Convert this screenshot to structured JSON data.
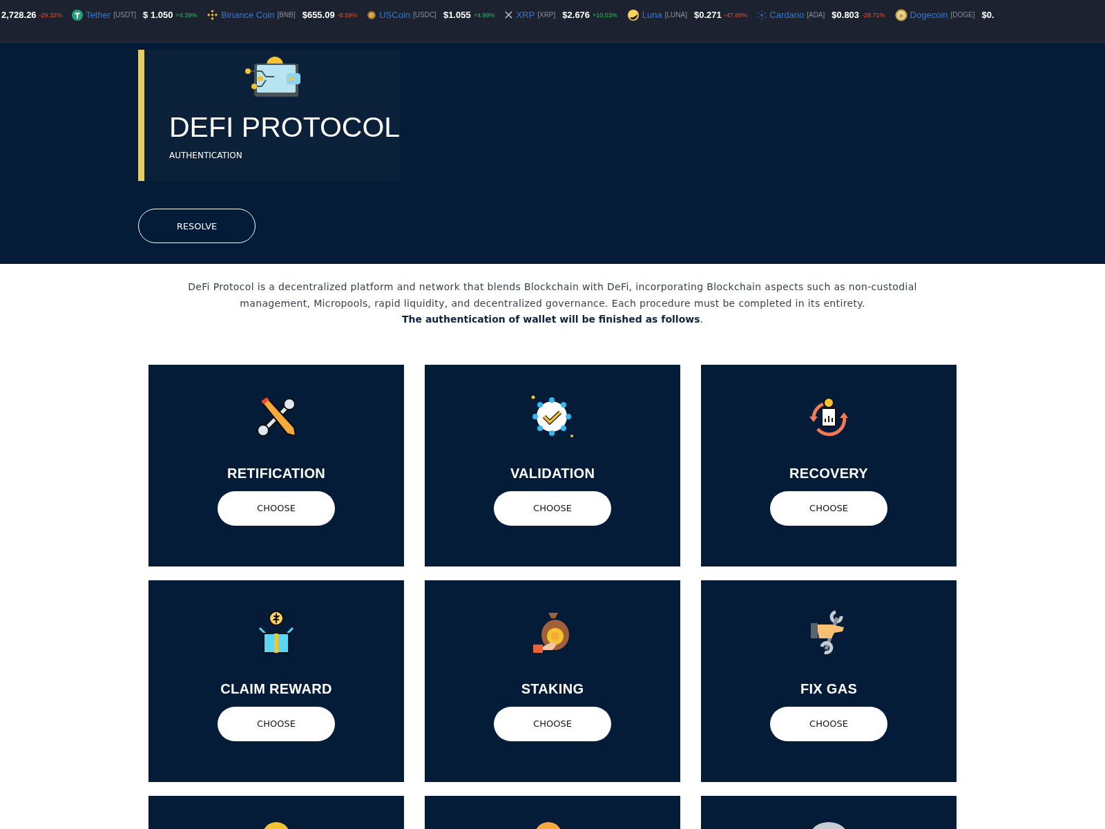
{
  "ticker": [
    {
      "price": "2,728.26",
      "change": "-29.32%",
      "rising": false
    },
    {
      "name": "Tether",
      "symbol": "[USDT]",
      "price": "$ 1.050",
      "change": "+4.39%",
      "rising": true
    },
    {
      "name": "Binance Coin",
      "symbol": "[BNB]",
      "price": "$655.09",
      "change": "-8.59%",
      "rising": false
    },
    {
      "name": "USCoin",
      "symbol": "[USDC]",
      "price": "$1.055",
      "change": "+4.99%",
      "rising": true
    },
    {
      "name": "XRP",
      "symbol": "[XRP]",
      "price": "$2.676",
      "change": "+10.53%",
      "rising": true
    },
    {
      "name": "Luna",
      "symbol": "[LUNA]",
      "price": "$0.271",
      "change": "-47.88%",
      "rising": false
    },
    {
      "name": "Cardano",
      "symbol": "[ADA]",
      "price": "$0.803",
      "change": "-28.71%",
      "rising": false
    },
    {
      "name": "Dogecoin",
      "symbol": "[DOGE]",
      "price": "$0."
    }
  ],
  "hero": {
    "title": "DEFI PROTOCOL",
    "subtitle": "AUTHENTICATION",
    "button": "RESOLVE"
  },
  "intro": "DeFi Protocol is a decentralized platform and network that blends Blockchain with DeFi, incorporating Blockchain aspects such as non-custodial management, Micropools, rapid liquidity, and decentralized governance. Each procedure must be completed in its entirety.",
  "intro_note": "**The authentication of wallet will be finished as follows**.",
  "cards": [
    {
      "kind": "full",
      "title": "RETIFICATION",
      "button": "CHOOSE"
    },
    {
      "kind": "full",
      "title": "VALIDATION",
      "button": "CHOOSE"
    },
    {
      "kind": "full",
      "title": "RECOVERY",
      "button": "CHOOSE"
    },
    {
      "kind": "full",
      "title": "CLAIM REWARD",
      "button": "CHOOSE"
    },
    {
      "kind": "full",
      "title": "STAKING",
      "button": "CHOOSE"
    },
    {
      "kind": "full",
      "title": "FIX GAS",
      "button": "CHOOSE"
    },
    {
      "kind": "partial"
    },
    {
      "kind": "partial"
    },
    {
      "kind": "partial"
    }
  ]
}
